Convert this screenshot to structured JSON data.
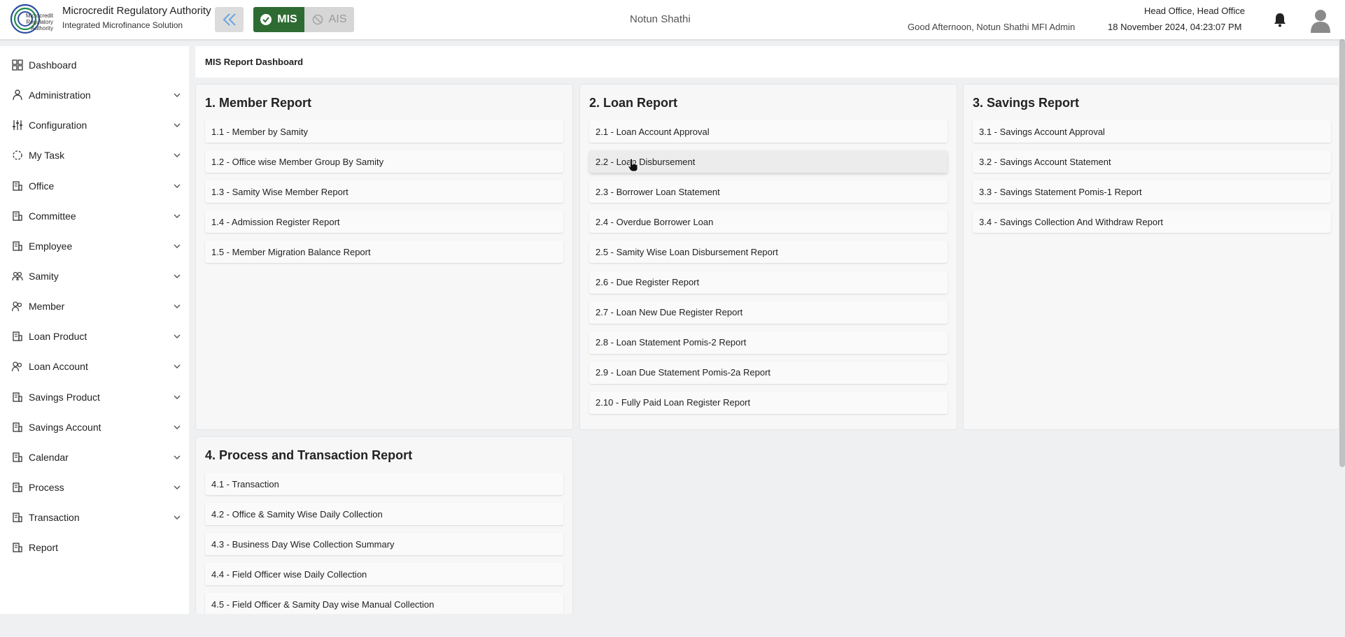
{
  "header": {
    "logo_text": [
      "Microcredit",
      "Regulatory",
      "Authority"
    ],
    "app_title": "Microcredit Regulatory Authority",
    "app_subtitle": "Integrated Microfinance Solution",
    "mode_mis": "MIS",
    "mode_ais": "AIS",
    "org_name": "Notun Shathi",
    "greeting": "Good Afternoon, Notun Shathi MFI Admin",
    "office": "Head Office, Head Office",
    "datetime": "18 November 2024, 04:23:07 PM"
  },
  "sidebar": {
    "items": [
      {
        "label": "Dashboard",
        "icon": "dashboard-icon",
        "expandable": false
      },
      {
        "label": "Administration",
        "icon": "admin-icon",
        "expandable": true
      },
      {
        "label": "Configuration",
        "icon": "sliders-icon",
        "expandable": true
      },
      {
        "label": "My Task",
        "icon": "task-icon",
        "expandable": true
      },
      {
        "label": "Office",
        "icon": "building-icon",
        "expandable": true
      },
      {
        "label": "Committee",
        "icon": "building-icon",
        "expandable": true
      },
      {
        "label": "Employee",
        "icon": "building-icon",
        "expandable": true
      },
      {
        "label": "Samity",
        "icon": "group-icon",
        "expandable": true
      },
      {
        "label": "Member",
        "icon": "users-icon",
        "expandable": true
      },
      {
        "label": "Loan Product",
        "icon": "building-icon",
        "expandable": true
      },
      {
        "label": "Loan Account",
        "icon": "users-icon",
        "expandable": true
      },
      {
        "label": "Savings Product",
        "icon": "building-icon",
        "expandable": true
      },
      {
        "label": "Savings Account",
        "icon": "building-icon",
        "expandable": true
      },
      {
        "label": "Calendar",
        "icon": "building-icon",
        "expandable": true
      },
      {
        "label": "Process",
        "icon": "building-icon",
        "expandable": true
      },
      {
        "label": "Transaction",
        "icon": "building-icon",
        "expandable": true
      },
      {
        "label": "Report",
        "icon": "building-icon",
        "expandable": false
      }
    ]
  },
  "breadcrumb": {
    "title": "MIS Report Dashboard"
  },
  "reports": {
    "member": {
      "title": "1. Member Report",
      "items": [
        "1.1 - Member by Samity",
        "1.2 - Office wise Member Group By Samity",
        "1.3 - Samity Wise Member Report",
        "1.4 - Admission Register Report",
        "1.5 - Member Migration Balance Report"
      ]
    },
    "loan": {
      "title": "2. Loan Report",
      "items": [
        "2.1 - Loan Account Approval",
        "2.2 - Loan Disbursement",
        "2.3 - Borrower Loan Statement",
        "2.4 - Overdue Borrower Loan",
        "2.5 - Samity Wise Loan Disbursement Report",
        "2.6 - Due Register Report",
        "2.7 - Loan New Due Register Report",
        "2.8 - Loan Statement Pomis-2 Report",
        "2.9 - Loan Due Statement Pomis-2a Report",
        "2.10 - Fully Paid Loan Register Report"
      ]
    },
    "savings": {
      "title": "3. Savings Report",
      "items": [
        "3.1 - Savings Account Approval",
        "3.2 - Savings Account Statement",
        "3.3 - Savings Statement Pomis-1 Report",
        "3.4 - Savings Collection And Withdraw Report"
      ]
    },
    "process": {
      "title": "4. Process and Transaction Report",
      "items": [
        "4.1 - Transaction",
        "4.2 - Office & Samity Wise Daily Collection",
        "4.3 - Business Day Wise Collection Summary",
        "4.4 - Field Officer wise Daily Collection",
        "4.5 - Field Officer & Samity Day wise Manual Collection"
      ]
    }
  },
  "colors": {
    "mis_active": "#2e6b32",
    "logo_green": "#1f8a4c",
    "logo_blue": "#2b4fa3"
  }
}
